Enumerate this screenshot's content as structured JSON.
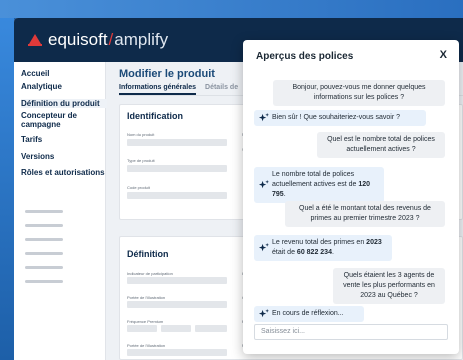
{
  "header": {
    "logo_main": "equisoft",
    "logo_slash": "/",
    "logo_sub": "amplify"
  },
  "sidebar": {
    "items": [
      {
        "label": "Accueil"
      },
      {
        "label": "Analytique"
      },
      {
        "label": "Définition du produit"
      },
      {
        "label": "Concepteur de campagne"
      },
      {
        "label": "Tarifs"
      },
      {
        "label": "Versions"
      },
      {
        "label": "Rôles et autorisations"
      }
    ]
  },
  "main": {
    "title": "Modifier le produit",
    "tabs": [
      {
        "label": "Informations générales"
      },
      {
        "label": "Détails de"
      }
    ],
    "identification": {
      "title": "Identification",
      "fields": [
        "Nom du produit",
        "Type de produit",
        "Code produit",
        "Nom o",
        "Secte"
      ]
    },
    "definition": {
      "title": "Définition",
      "fields": [
        "Indicateur de participation",
        "Portée de l'illustration",
        "Fréquence Premium",
        "Portée de l'illustration",
        "Indica",
        "Catég",
        "Police",
        "Maxim"
      ]
    }
  },
  "chat": {
    "title": "Aperçus des polices",
    "close": "X",
    "messages": [
      {
        "role": "user",
        "text": "Bonjour, pouvez-vous me donner quelques informations sur les polices ?"
      },
      {
        "role": "assistant",
        "text": "Bien sûr ! Que souhaiteriez-vous savoir ?"
      },
      {
        "role": "user",
        "text": "Quel est le nombre total de polices actuellement actives ?"
      },
      {
        "role": "assistant",
        "text_before": "Le nombre total de polices actuellement actives est de ",
        "emphasis": "120 795",
        "text_after": "."
      },
      {
        "role": "user",
        "text": "Quel a été le montant total des revenus de primes au premier trimestre 2023 ?"
      },
      {
        "role": "assistant",
        "text_before": "Le revenu total des primes en ",
        "emphasis": "2023",
        "text_middle": " était de ",
        "emphasis2": "60 822 234",
        "text_after": "."
      },
      {
        "role": "user",
        "text": "Quels étaient les 3 agents de vente les plus performants en 2023 au Québec ?"
      },
      {
        "role": "assistant",
        "text": "En cours de réflexion..."
      }
    ],
    "input_placeholder": "Saisissez ici..."
  },
  "colors": {
    "brand_navy": "#0e2a4a",
    "accent_red": "#e03a3a",
    "frame_blue": "#1f5fa6"
  }
}
